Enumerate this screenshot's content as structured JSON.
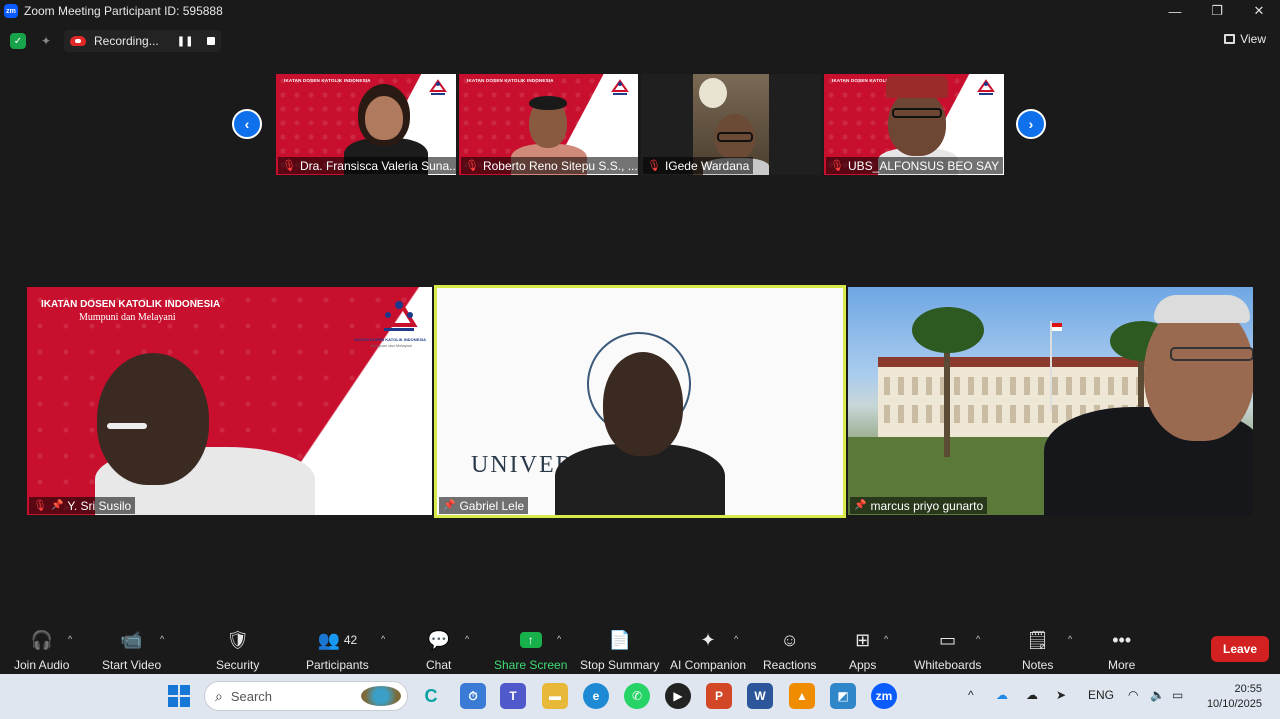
{
  "window": {
    "title": "Zoom Meeting Participant ID: 595888",
    "app_badge": "zm",
    "controls": {
      "minimize": "—",
      "restore": "❐",
      "close": "✕"
    }
  },
  "recording": {
    "label": "Recording...",
    "pause_glyph": "❚❚"
  },
  "view_label": "View",
  "thumbnails": [
    {
      "name": "Dra. Fransisca Valeria Suna...",
      "muted": true,
      "background": "ikdki"
    },
    {
      "name": "Roberto Reno Sitepu S.S., ...",
      "muted": true,
      "background": "ikdki"
    },
    {
      "name": "IGede Wardana",
      "muted": true,
      "background": "room"
    },
    {
      "name": "UBS_ALFONSUS BEO SAY",
      "muted": true,
      "background": "ikdki"
    }
  ],
  "slide_header": "IKATAN DOSEN KATOLIK INDONESIA",
  "slide_subtitle": "Mumpuni dan Melayani",
  "logo_caption": "IKATAN DOSEN KATOLIK INDONESIA",
  "logo_tagline": "Mumpuni dan Melayani",
  "tiles": [
    {
      "name": "Y. Sri Susilo",
      "muted": true,
      "pinned": true
    },
    {
      "name": "Gabriel Lele",
      "muted": false,
      "pinned": true,
      "active": true,
      "bg_text": "UNIVERSIT       MADA"
    },
    {
      "name": "marcus priyo gunarto",
      "muted": false,
      "pinned": true
    }
  ],
  "toolbar": {
    "join_audio": "Join Audio",
    "start_video": "Start Video",
    "security": "Security",
    "participants": "Participants",
    "participants_count": "42",
    "chat": "Chat",
    "share_screen": "Share Screen",
    "stop_summary": "Stop Summary",
    "ai_companion": "AI Companion",
    "reactions": "Reactions",
    "apps": "Apps",
    "whiteboards": "Whiteboards",
    "notes": "Notes",
    "more": "More",
    "leave": "Leave"
  },
  "taskbar": {
    "search_placeholder": "Search",
    "language": "ENG",
    "time": "20:55",
    "date": "10/10/2025"
  },
  "colors": {
    "zoom_blue": "#0e71eb",
    "ikdki_red": "#c8102e",
    "active_speaker": "#d7ea48",
    "leave_red": "#d32121",
    "share_green": "#17b04b"
  }
}
